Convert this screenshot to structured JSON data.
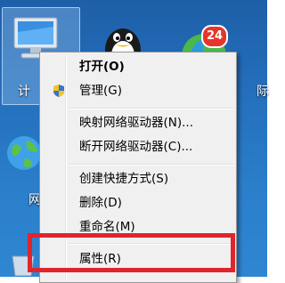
{
  "desktop": {
    "icons": {
      "computer_label": "计",
      "network_label": "网",
      "right_label": "际"
    },
    "store_badge": "24"
  },
  "context_menu": {
    "items": [
      {
        "label": "打开(O)"
      },
      {
        "label": "管理(G)"
      },
      {
        "label": "映射网络驱动器(N)..."
      },
      {
        "label": "断开网络驱动器(C)..."
      },
      {
        "label": "创建快捷方式(S)"
      },
      {
        "label": "删除(D)"
      },
      {
        "label": "重命名(M)"
      },
      {
        "label": "属性(R)"
      }
    ]
  },
  "colors": {
    "highlight_box": "#e0242c",
    "desktop_blue": "#2470bd",
    "menu_bg": "#f0f0f0"
  }
}
